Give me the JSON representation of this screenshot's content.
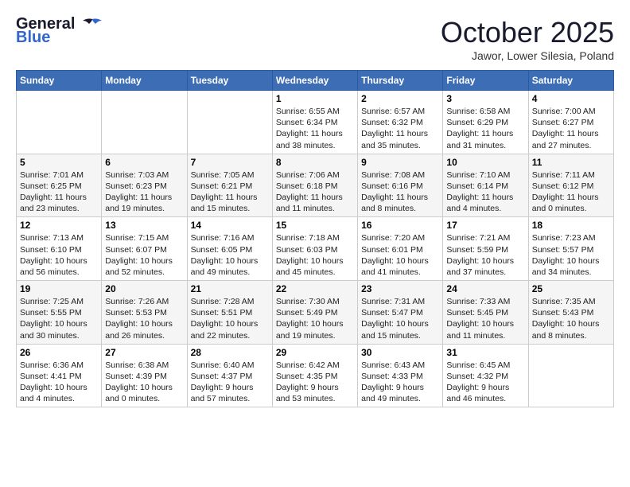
{
  "header": {
    "logo_general": "General",
    "logo_blue": "Blue",
    "month": "October 2025",
    "location": "Jawor, Lower Silesia, Poland"
  },
  "days_of_week": [
    "Sunday",
    "Monday",
    "Tuesday",
    "Wednesday",
    "Thursday",
    "Friday",
    "Saturday"
  ],
  "weeks": [
    {
      "days": [
        {
          "num": "",
          "info": ""
        },
        {
          "num": "",
          "info": ""
        },
        {
          "num": "",
          "info": ""
        },
        {
          "num": "1",
          "info": "Sunrise: 6:55 AM\nSunset: 6:34 PM\nDaylight: 11 hours\nand 38 minutes."
        },
        {
          "num": "2",
          "info": "Sunrise: 6:57 AM\nSunset: 6:32 PM\nDaylight: 11 hours\nand 35 minutes."
        },
        {
          "num": "3",
          "info": "Sunrise: 6:58 AM\nSunset: 6:29 PM\nDaylight: 11 hours\nand 31 minutes."
        },
        {
          "num": "4",
          "info": "Sunrise: 7:00 AM\nSunset: 6:27 PM\nDaylight: 11 hours\nand 27 minutes."
        }
      ]
    },
    {
      "days": [
        {
          "num": "5",
          "info": "Sunrise: 7:01 AM\nSunset: 6:25 PM\nDaylight: 11 hours\nand 23 minutes."
        },
        {
          "num": "6",
          "info": "Sunrise: 7:03 AM\nSunset: 6:23 PM\nDaylight: 11 hours\nand 19 minutes."
        },
        {
          "num": "7",
          "info": "Sunrise: 7:05 AM\nSunset: 6:21 PM\nDaylight: 11 hours\nand 15 minutes."
        },
        {
          "num": "8",
          "info": "Sunrise: 7:06 AM\nSunset: 6:18 PM\nDaylight: 11 hours\nand 11 minutes."
        },
        {
          "num": "9",
          "info": "Sunrise: 7:08 AM\nSunset: 6:16 PM\nDaylight: 11 hours\nand 8 minutes."
        },
        {
          "num": "10",
          "info": "Sunrise: 7:10 AM\nSunset: 6:14 PM\nDaylight: 11 hours\nand 4 minutes."
        },
        {
          "num": "11",
          "info": "Sunrise: 7:11 AM\nSunset: 6:12 PM\nDaylight: 11 hours\nand 0 minutes."
        }
      ]
    },
    {
      "days": [
        {
          "num": "12",
          "info": "Sunrise: 7:13 AM\nSunset: 6:10 PM\nDaylight: 10 hours\nand 56 minutes."
        },
        {
          "num": "13",
          "info": "Sunrise: 7:15 AM\nSunset: 6:07 PM\nDaylight: 10 hours\nand 52 minutes."
        },
        {
          "num": "14",
          "info": "Sunrise: 7:16 AM\nSunset: 6:05 PM\nDaylight: 10 hours\nand 49 minutes."
        },
        {
          "num": "15",
          "info": "Sunrise: 7:18 AM\nSunset: 6:03 PM\nDaylight: 10 hours\nand 45 minutes."
        },
        {
          "num": "16",
          "info": "Sunrise: 7:20 AM\nSunset: 6:01 PM\nDaylight: 10 hours\nand 41 minutes."
        },
        {
          "num": "17",
          "info": "Sunrise: 7:21 AM\nSunset: 5:59 PM\nDaylight: 10 hours\nand 37 minutes."
        },
        {
          "num": "18",
          "info": "Sunrise: 7:23 AM\nSunset: 5:57 PM\nDaylight: 10 hours\nand 34 minutes."
        }
      ]
    },
    {
      "days": [
        {
          "num": "19",
          "info": "Sunrise: 7:25 AM\nSunset: 5:55 PM\nDaylight: 10 hours\nand 30 minutes."
        },
        {
          "num": "20",
          "info": "Sunrise: 7:26 AM\nSunset: 5:53 PM\nDaylight: 10 hours\nand 26 minutes."
        },
        {
          "num": "21",
          "info": "Sunrise: 7:28 AM\nSunset: 5:51 PM\nDaylight: 10 hours\nand 22 minutes."
        },
        {
          "num": "22",
          "info": "Sunrise: 7:30 AM\nSunset: 5:49 PM\nDaylight: 10 hours\nand 19 minutes."
        },
        {
          "num": "23",
          "info": "Sunrise: 7:31 AM\nSunset: 5:47 PM\nDaylight: 10 hours\nand 15 minutes."
        },
        {
          "num": "24",
          "info": "Sunrise: 7:33 AM\nSunset: 5:45 PM\nDaylight: 10 hours\nand 11 minutes."
        },
        {
          "num": "25",
          "info": "Sunrise: 7:35 AM\nSunset: 5:43 PM\nDaylight: 10 hours\nand 8 minutes."
        }
      ]
    },
    {
      "days": [
        {
          "num": "26",
          "info": "Sunrise: 6:36 AM\nSunset: 4:41 PM\nDaylight: 10 hours\nand 4 minutes."
        },
        {
          "num": "27",
          "info": "Sunrise: 6:38 AM\nSunset: 4:39 PM\nDaylight: 10 hours\nand 0 minutes."
        },
        {
          "num": "28",
          "info": "Sunrise: 6:40 AM\nSunset: 4:37 PM\nDaylight: 9 hours\nand 57 minutes."
        },
        {
          "num": "29",
          "info": "Sunrise: 6:42 AM\nSunset: 4:35 PM\nDaylight: 9 hours\nand 53 minutes."
        },
        {
          "num": "30",
          "info": "Sunrise: 6:43 AM\nSunset: 4:33 PM\nDaylight: 9 hours\nand 49 minutes."
        },
        {
          "num": "31",
          "info": "Sunrise: 6:45 AM\nSunset: 4:32 PM\nDaylight: 9 hours\nand 46 minutes."
        },
        {
          "num": "",
          "info": ""
        }
      ]
    }
  ]
}
